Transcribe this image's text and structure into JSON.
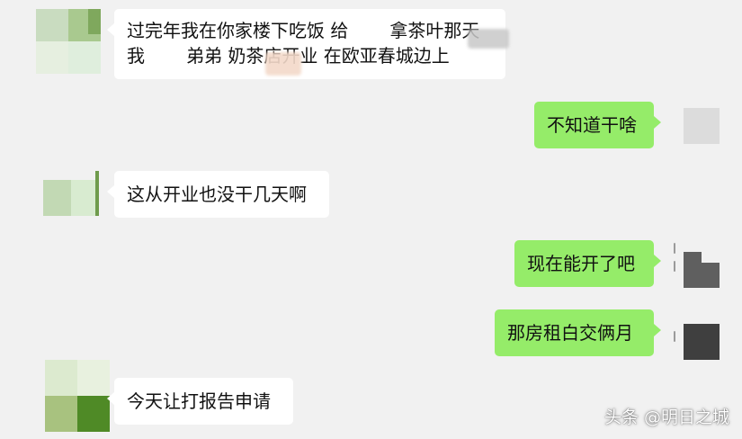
{
  "chat": {
    "messages": [
      {
        "side": "left",
        "lines": [
          "过完年我在你家楼下吃饭 给",
          "拿茶叶那天",
          "我",
          "弟弟 奶茶店开业 在欧亚春城边上"
        ]
      },
      {
        "side": "right",
        "text": "不知道干啥"
      },
      {
        "side": "left",
        "text": "这从开业也没干几天啊"
      },
      {
        "side": "right",
        "text": "现在能开了吧"
      },
      {
        "side": "right",
        "text": "那房租白交俩月"
      },
      {
        "side": "left",
        "text": "今天让打报告申请"
      }
    ]
  },
  "watermark": {
    "text": "头条 @明日之城"
  }
}
